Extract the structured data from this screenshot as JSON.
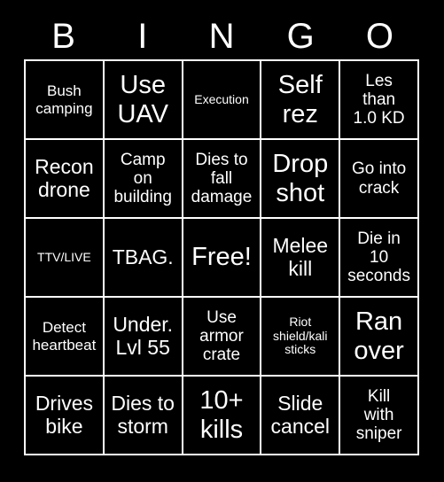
{
  "card": {
    "background_color": "#000000",
    "text_color": "#ffffff",
    "header": {
      "letters": [
        "B",
        "I",
        "N",
        "G",
        "O"
      ]
    },
    "grid": {
      "rows": 5,
      "columns": 5,
      "cells": [
        {
          "text": "Bush\ncamping",
          "size": "s"
        },
        {
          "text": "Use\nUAV",
          "size": "xl"
        },
        {
          "text": "Execution",
          "size": "xs"
        },
        {
          "text": "Self\nrez",
          "size": "xl"
        },
        {
          "text": "Les\nthan\n1.0 KD",
          "size": "m"
        },
        {
          "text": "Recon\ndrone",
          "size": "l"
        },
        {
          "text": "Camp\non\nbuilding",
          "size": "m"
        },
        {
          "text": "Dies to\nfall\ndamage",
          "size": "m"
        },
        {
          "text": "Drop\nshot",
          "size": "xl"
        },
        {
          "text": "Go into\ncrack",
          "size": "m"
        },
        {
          "text": "TTV/LIVE",
          "size": "xs"
        },
        {
          "text": "TBAG.",
          "size": "l"
        },
        {
          "text": "Free!",
          "size": "xl"
        },
        {
          "text": "Melee\nkill",
          "size": "l"
        },
        {
          "text": "Die in\n10\nseconds",
          "size": "m"
        },
        {
          "text": "Detect\nheartbeat",
          "size": "s"
        },
        {
          "text": "Under.\nLvl 55",
          "size": "l"
        },
        {
          "text": "Use\narmor\ncrate",
          "size": "m"
        },
        {
          "text": "Riot\nshield/kali\nsticks",
          "size": "xs"
        },
        {
          "text": "Ran\nover",
          "size": "xl"
        },
        {
          "text": "Drives\nbike",
          "size": "l"
        },
        {
          "text": "Dies to\nstorm",
          "size": "l"
        },
        {
          "text": "10+\nkills",
          "size": "xl"
        },
        {
          "text": "Slide\ncancel",
          "size": "l"
        },
        {
          "text": "Kill\nwith\nsniper",
          "size": "m"
        }
      ]
    }
  }
}
